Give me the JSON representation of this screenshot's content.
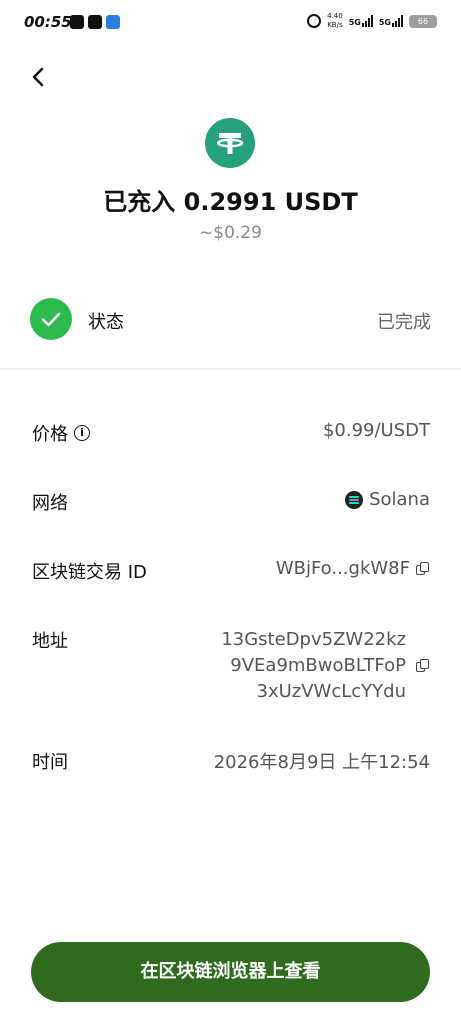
{
  "status_bar": {
    "time": "00:55",
    "net_speed_value": "4.40",
    "net_speed_unit": "KB/s",
    "sim1": "5G",
    "sim2": "5G",
    "battery": "66"
  },
  "header": {
    "back_icon": "chevron-left-icon"
  },
  "summary": {
    "token_icon": "tether-usdt-icon",
    "token_color": "#26a17b",
    "title": "已充入 0.2991 USDT",
    "fiat_value": "~$0.29"
  },
  "status": {
    "icon": "check-circle-icon",
    "color": "#2dbb4e",
    "label": "状态",
    "value": "已完成"
  },
  "details": {
    "price": {
      "label": "价格",
      "value": "$0.99/USDT"
    },
    "network": {
      "label": "网络",
      "value": "Solana"
    },
    "txid": {
      "label": "区块链交易 ID",
      "value": "WBjFo...gkW8F"
    },
    "address": {
      "label": "地址",
      "lines": [
        "13GsteDpv5ZW22kz",
        "9VEa9mBwoBLTFoP",
        "3xUzVWcLcYYdu"
      ]
    },
    "time": {
      "label": "时间",
      "value": "2026年8月9日 上午12:54"
    }
  },
  "cta": {
    "label": "在区块链浏览器上查看",
    "color": "#2f6b1e"
  }
}
